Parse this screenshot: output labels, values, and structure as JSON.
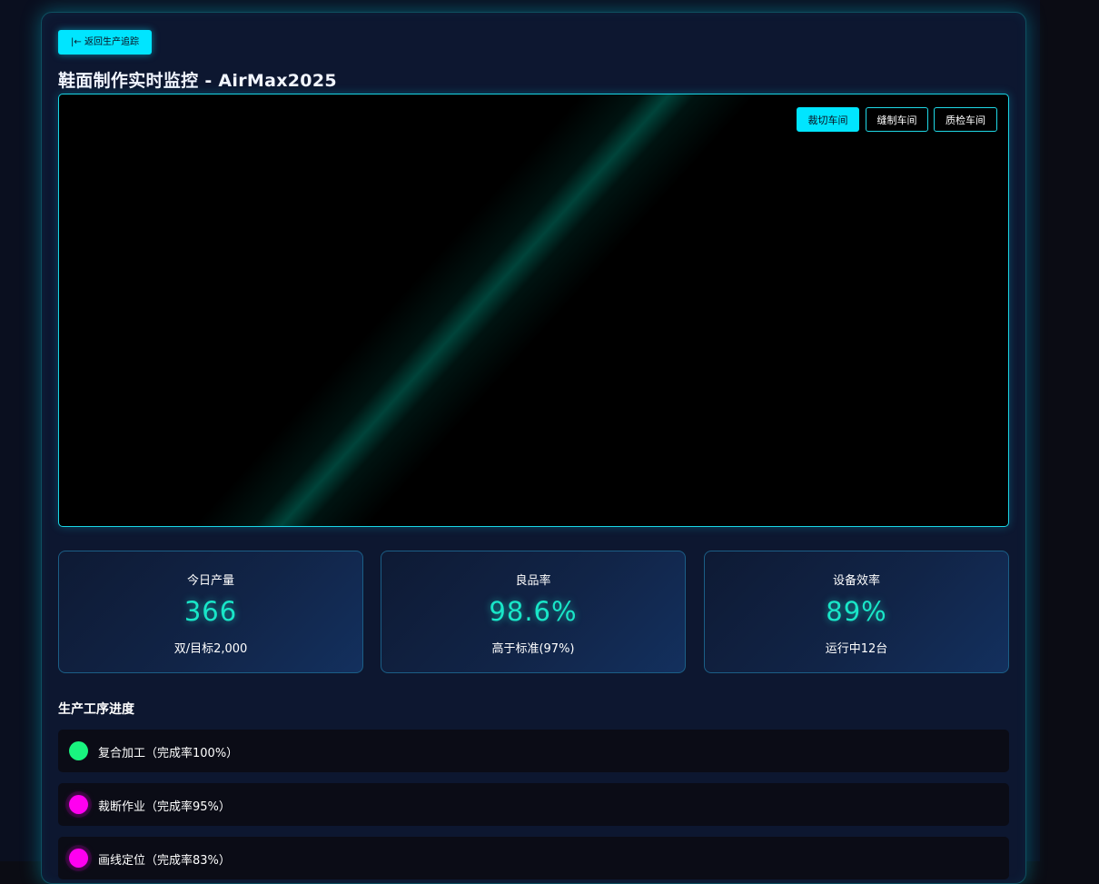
{
  "back_button": {
    "label": "|← 返回生产追踪"
  },
  "page_title": "鞋面制作实时监控 - AirMax2025",
  "workshops": [
    {
      "label": "裁切车间",
      "active": true
    },
    {
      "label": "缝制车间",
      "active": false
    },
    {
      "label": "质检车间",
      "active": false
    }
  ],
  "stats": [
    {
      "label": "今日产量",
      "value": "366",
      "sub": "双/目标2,000"
    },
    {
      "label": "良品率",
      "value": "98.6%",
      "sub": "高于标准(97%)"
    },
    {
      "label": "设备效率",
      "value": "89%",
      "sub": "运行中12台"
    }
  ],
  "process_section": {
    "title": "生产工序进度",
    "steps": [
      {
        "label": "复合加工（完成率100%）",
        "status": "done"
      },
      {
        "label": "裁断作业（完成率95%）",
        "status": "active"
      },
      {
        "label": "画线定位（完成率83%）",
        "status": "active"
      }
    ]
  },
  "colors": {
    "accent": "#00e5ff",
    "stat_value": "#19e6c8",
    "step_done": "#19f57f",
    "step_active": "#ff00f0",
    "panel_bg": "#0d1730"
  }
}
